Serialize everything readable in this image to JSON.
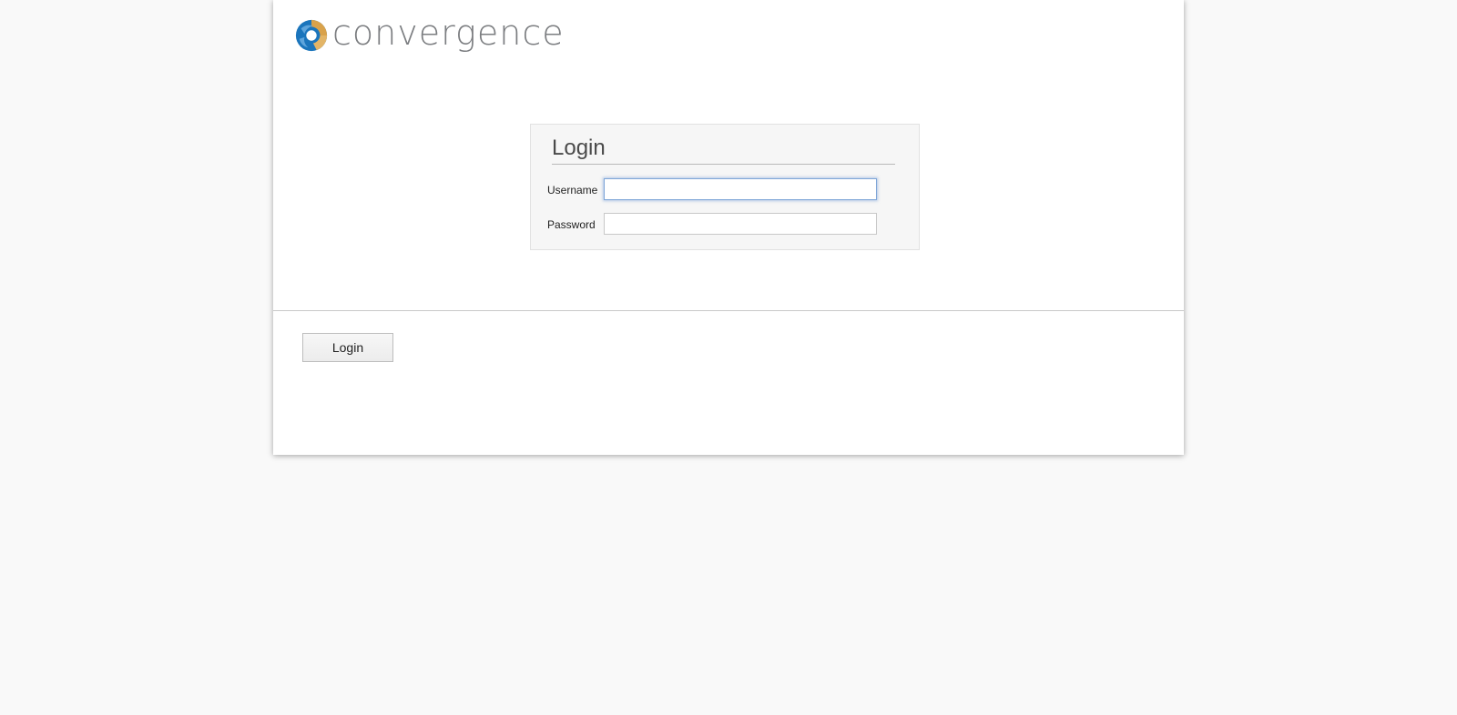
{
  "brand": {
    "name": "convergence",
    "logo_icon": "swirl-logo-icon",
    "colors": {
      "blue": "#1b75bc",
      "gold": "#d9a24b",
      "text": "#7b7d80"
    }
  },
  "login_panel": {
    "title": "Login",
    "username_label": "Username",
    "username_value": "",
    "password_label": "Password",
    "password_value": ""
  },
  "actions": {
    "login_label": "Login"
  },
  "colors": {
    "page_background": "#f9f9f9",
    "panel_background": "#f6f6f6",
    "focus_ring": "#7fa6d8"
  }
}
